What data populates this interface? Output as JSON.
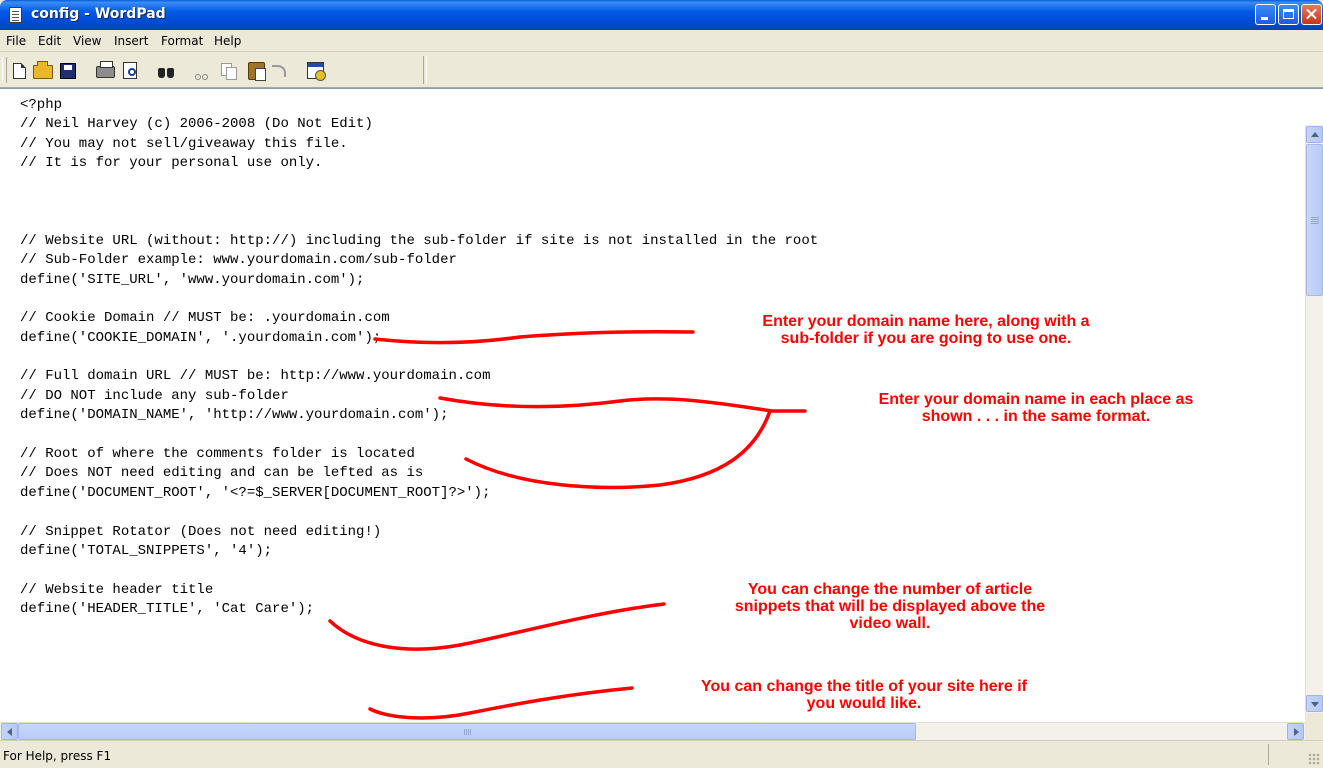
{
  "window": {
    "title": "config - WordPad"
  },
  "menu": [
    "File",
    "Edit",
    "View",
    "Insert",
    "Format",
    "Help"
  ],
  "toolbar": {
    "buttons": [
      {
        "name": "new-icon"
      },
      {
        "name": "open-icon"
      },
      {
        "name": "save-icon"
      },
      {
        "name": "print-icon"
      },
      {
        "name": "print-preview-icon"
      },
      {
        "name": "find-icon"
      },
      {
        "name": "cut-icon"
      },
      {
        "name": "copy-icon"
      },
      {
        "name": "paste-icon"
      },
      {
        "name": "undo-icon"
      },
      {
        "name": "date-time-icon"
      }
    ]
  },
  "document": {
    "lines": [
      "<?php",
      "// Neil Harvey (c) 2006-2008 (Do Not Edit)",
      "// You may not sell/giveaway this file.",
      "// It is for your personal use only.",
      "",
      "",
      "",
      "// Website URL (without: http://) including the sub-folder if site is not installed in the root",
      "// Sub-Folder example: www.yourdomain.com/sub-folder",
      "define('SITE_URL', 'www.yourdomain.com');",
      "",
      "// Cookie Domain // MUST be: .yourdomain.com",
      "define('COOKIE_DOMAIN', '.yourdomain.com');",
      "",
      "// Full domain URL // MUST be: http://www.yourdomain.com",
      "// DO NOT include any sub-folder",
      "define('DOMAIN_NAME', 'http://www.yourdomain.com');",
      "",
      "// Root of where the comments folder is located",
      "// Does NOT need editing and can be lefted as is",
      "define('DOCUMENT_ROOT', '<?=$_SERVER[DOCUMENT_ROOT]?>');",
      "",
      "// Snippet Rotator (Does not need editing!)",
      "define('TOTAL_SNIPPETS', '4');",
      "",
      "// Website header title",
      "define('HEADER_TITLE', 'Cat Care');"
    ]
  },
  "annotations": {
    "site_url": [
      "Enter your domain name here, along with a",
      "sub-folder if you are going to use one."
    ],
    "domain": [
      "Enter your domain name in each place as",
      "shown . . . in the same format."
    ],
    "snippets": [
      "You can change the number of article",
      "snippets that will be displayed above the",
      "video wall."
    ],
    "title": [
      "You can change the title of your site here if",
      "you would like."
    ],
    "color": "#ff0000"
  },
  "status": {
    "help_text": "For Help, press F1"
  }
}
